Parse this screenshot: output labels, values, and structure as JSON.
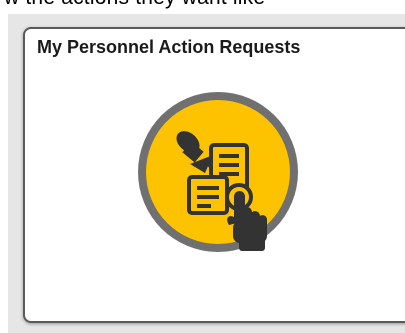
{
  "background_text": "w the actions they want like",
  "tile": {
    "title": "My Personnel Action Requests",
    "icon": "pushpin-document-hand-tap-icon",
    "colors": {
      "icon_fill": "#FDC300",
      "icon_ring": "#707070",
      "glyph": "#333333",
      "tile_border": "#5a5a5a"
    }
  }
}
